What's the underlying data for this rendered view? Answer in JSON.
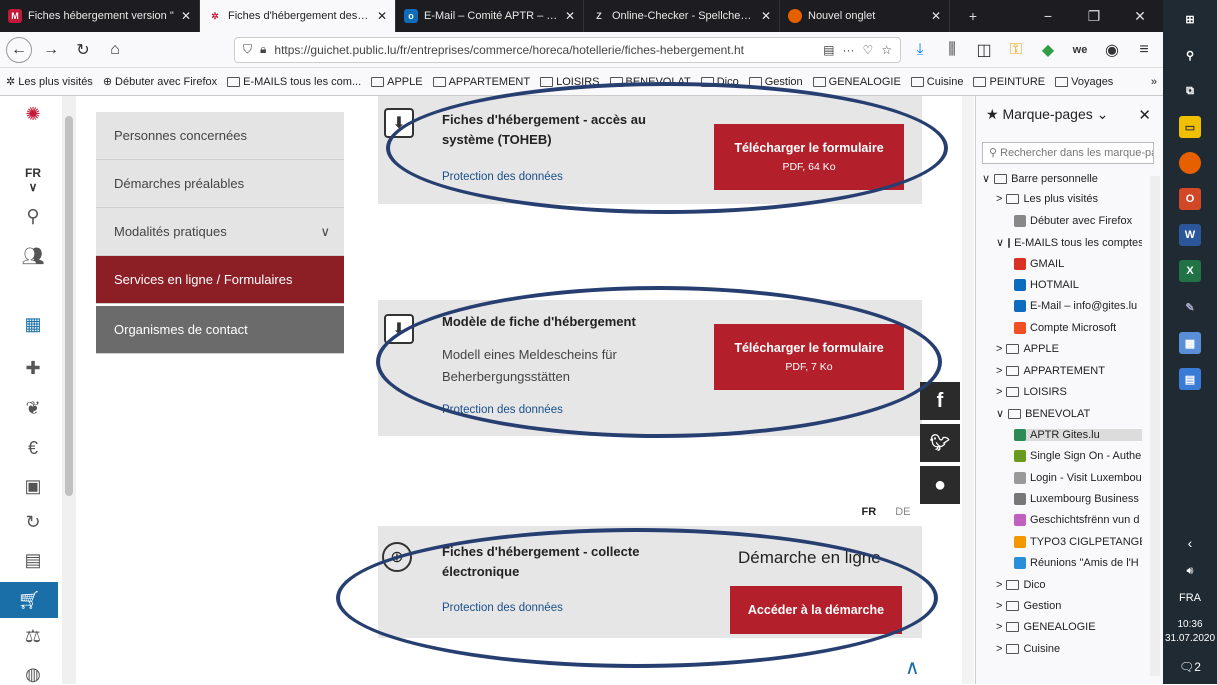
{
  "browser": {
    "tabs": [
      {
        "label": "Fiches hébergement version \"",
        "icon_color": "#c41a3a",
        "icon": "mail-icon",
        "active": false
      },
      {
        "label": "Fiches d'hébergement des voy",
        "icon_color": "#c41a3a",
        "icon": "gouv-icon",
        "active": true
      },
      {
        "label": "E-Mail – Comité APTR – Outlo",
        "icon_color": "#0f6cbd",
        "icon": "outlook-icon",
        "active": false
      },
      {
        "label": "Online-Checker - Spellchecker",
        "icon_color": "#444",
        "icon": "checker-icon",
        "active": false
      },
      {
        "label": "Nouvel onglet",
        "icon_color": "#e66000",
        "icon": "firefox-icon",
        "active": false
      }
    ],
    "url": "https://guichet.public.lu/fr/entreprises/commerce/horeca/hotellerie/fiches-hebergement.ht",
    "url_domain": "guichet.public.lu",
    "bookmarks": [
      "Les plus visités",
      "Débuter avec Firefox",
      "E-MAILS tous les com...",
      "APPLE",
      "APPARTEMENT",
      "LOISIRS",
      "BENEVOLAT",
      "Dico",
      "Gestion",
      "GENEALOGIE",
      "Cuisine",
      "PEINTURE",
      "Voyages"
    ]
  },
  "rail": {
    "lang": "FR ∨"
  },
  "menu": [
    {
      "label": "Personnes concernées",
      "style": "normal"
    },
    {
      "label": "Démarches préalables",
      "style": "normal"
    },
    {
      "label": "Modalités pratiques",
      "style": "normal",
      "chevron": "∨"
    },
    {
      "label": "Services en ligne / Formulaires",
      "style": "active"
    },
    {
      "label": "Organismes de contact",
      "style": "dark"
    }
  ],
  "cards": [
    {
      "title": "Fiches d'hébergement - accès au système (TOHEB)",
      "title_l1": "Fiches d'hébergement - accès au",
      "title_l2": "système (TOHEB)",
      "link": "Protection des données",
      "button": "Télécharger le formulaire",
      "size": "PDF, 64 Ko"
    },
    {
      "title": "Modèle de fiche d'hébergement",
      "subtitle_l1": "Modell eines Meldescheins für",
      "subtitle_l2": "Beherbergungsstätten",
      "link": "Protection des données",
      "button": "Télécharger le formulaire",
      "size": "PDF, 7 Ko"
    },
    {
      "title_l1": "Fiches d'hébergement - collecte",
      "title_l2": "électronique",
      "link": "Protection des données",
      "heading": "Démarche en ligne",
      "button": "Accéder à la démarche"
    }
  ],
  "lang_switch": {
    "fr": "FR",
    "de": "DE"
  },
  "sidebar": {
    "title": "Marque-pages",
    "search_placeholder": "Rechercher dans les marque-pag",
    "items": [
      {
        "label": "Barre personnelle",
        "level": 0,
        "kind": "folder-open"
      },
      {
        "label": "Les plus visités",
        "level": 1,
        "kind": "folder-closed"
      },
      {
        "label": "Débuter avec Firefox",
        "level": 2,
        "kind": "link"
      },
      {
        "label": "E-MAILS tous les comptes",
        "level": 1,
        "kind": "folder-open"
      },
      {
        "label": "GMAIL",
        "level": 2,
        "kind": "link",
        "color": "#d93025"
      },
      {
        "label": "HOTMAIL",
        "level": 2,
        "kind": "link",
        "color": "#0f6cbd"
      },
      {
        "label": "E-Mail – info@gites.lu",
        "level": 2,
        "kind": "link",
        "color": "#0f6cbd"
      },
      {
        "label": "Compte Microsoft",
        "level": 2,
        "kind": "link",
        "color": "#f25022"
      },
      {
        "label": "APPLE",
        "level": 1,
        "kind": "folder-closed"
      },
      {
        "label": "APPARTEMENT",
        "level": 1,
        "kind": "folder-closed"
      },
      {
        "label": "LOISIRS",
        "level": 1,
        "kind": "folder-closed"
      },
      {
        "label": "BENEVOLAT",
        "level": 1,
        "kind": "folder-open"
      },
      {
        "label": "APTR Gites.lu",
        "level": 2,
        "kind": "link",
        "color": "#2e8b57",
        "selected": true
      },
      {
        "label": "Single Sign On - Authe",
        "level": 2,
        "kind": "link",
        "color": "#6a9a1f"
      },
      {
        "label": "Login - Visit Luxembou",
        "level": 2,
        "kind": "link",
        "color": "#999"
      },
      {
        "label": "Luxembourg Business",
        "level": 2,
        "kind": "link",
        "color": "#777"
      },
      {
        "label": "Geschichtsfrënn vun d",
        "level": 2,
        "kind": "link",
        "color": "#c060c0"
      },
      {
        "label": "TYPO3 CIGLPETANGE [",
        "level": 2,
        "kind": "link",
        "color": "#f49700"
      },
      {
        "label": "Réunions \"Amis de l'H",
        "level": 2,
        "kind": "link",
        "color": "#2a8fd6"
      },
      {
        "label": "Dico",
        "level": 1,
        "kind": "folder-closed"
      },
      {
        "label": "Gestion",
        "level": 1,
        "kind": "folder-closed"
      },
      {
        "label": "GENEALOGIE",
        "level": 1,
        "kind": "folder-closed"
      },
      {
        "label": "Cuisine",
        "level": 1,
        "kind": "folder-closed"
      }
    ]
  },
  "taskbar": {
    "lang": "FRA",
    "time": "10:36",
    "date": "31.07.2020",
    "notif": "2"
  }
}
